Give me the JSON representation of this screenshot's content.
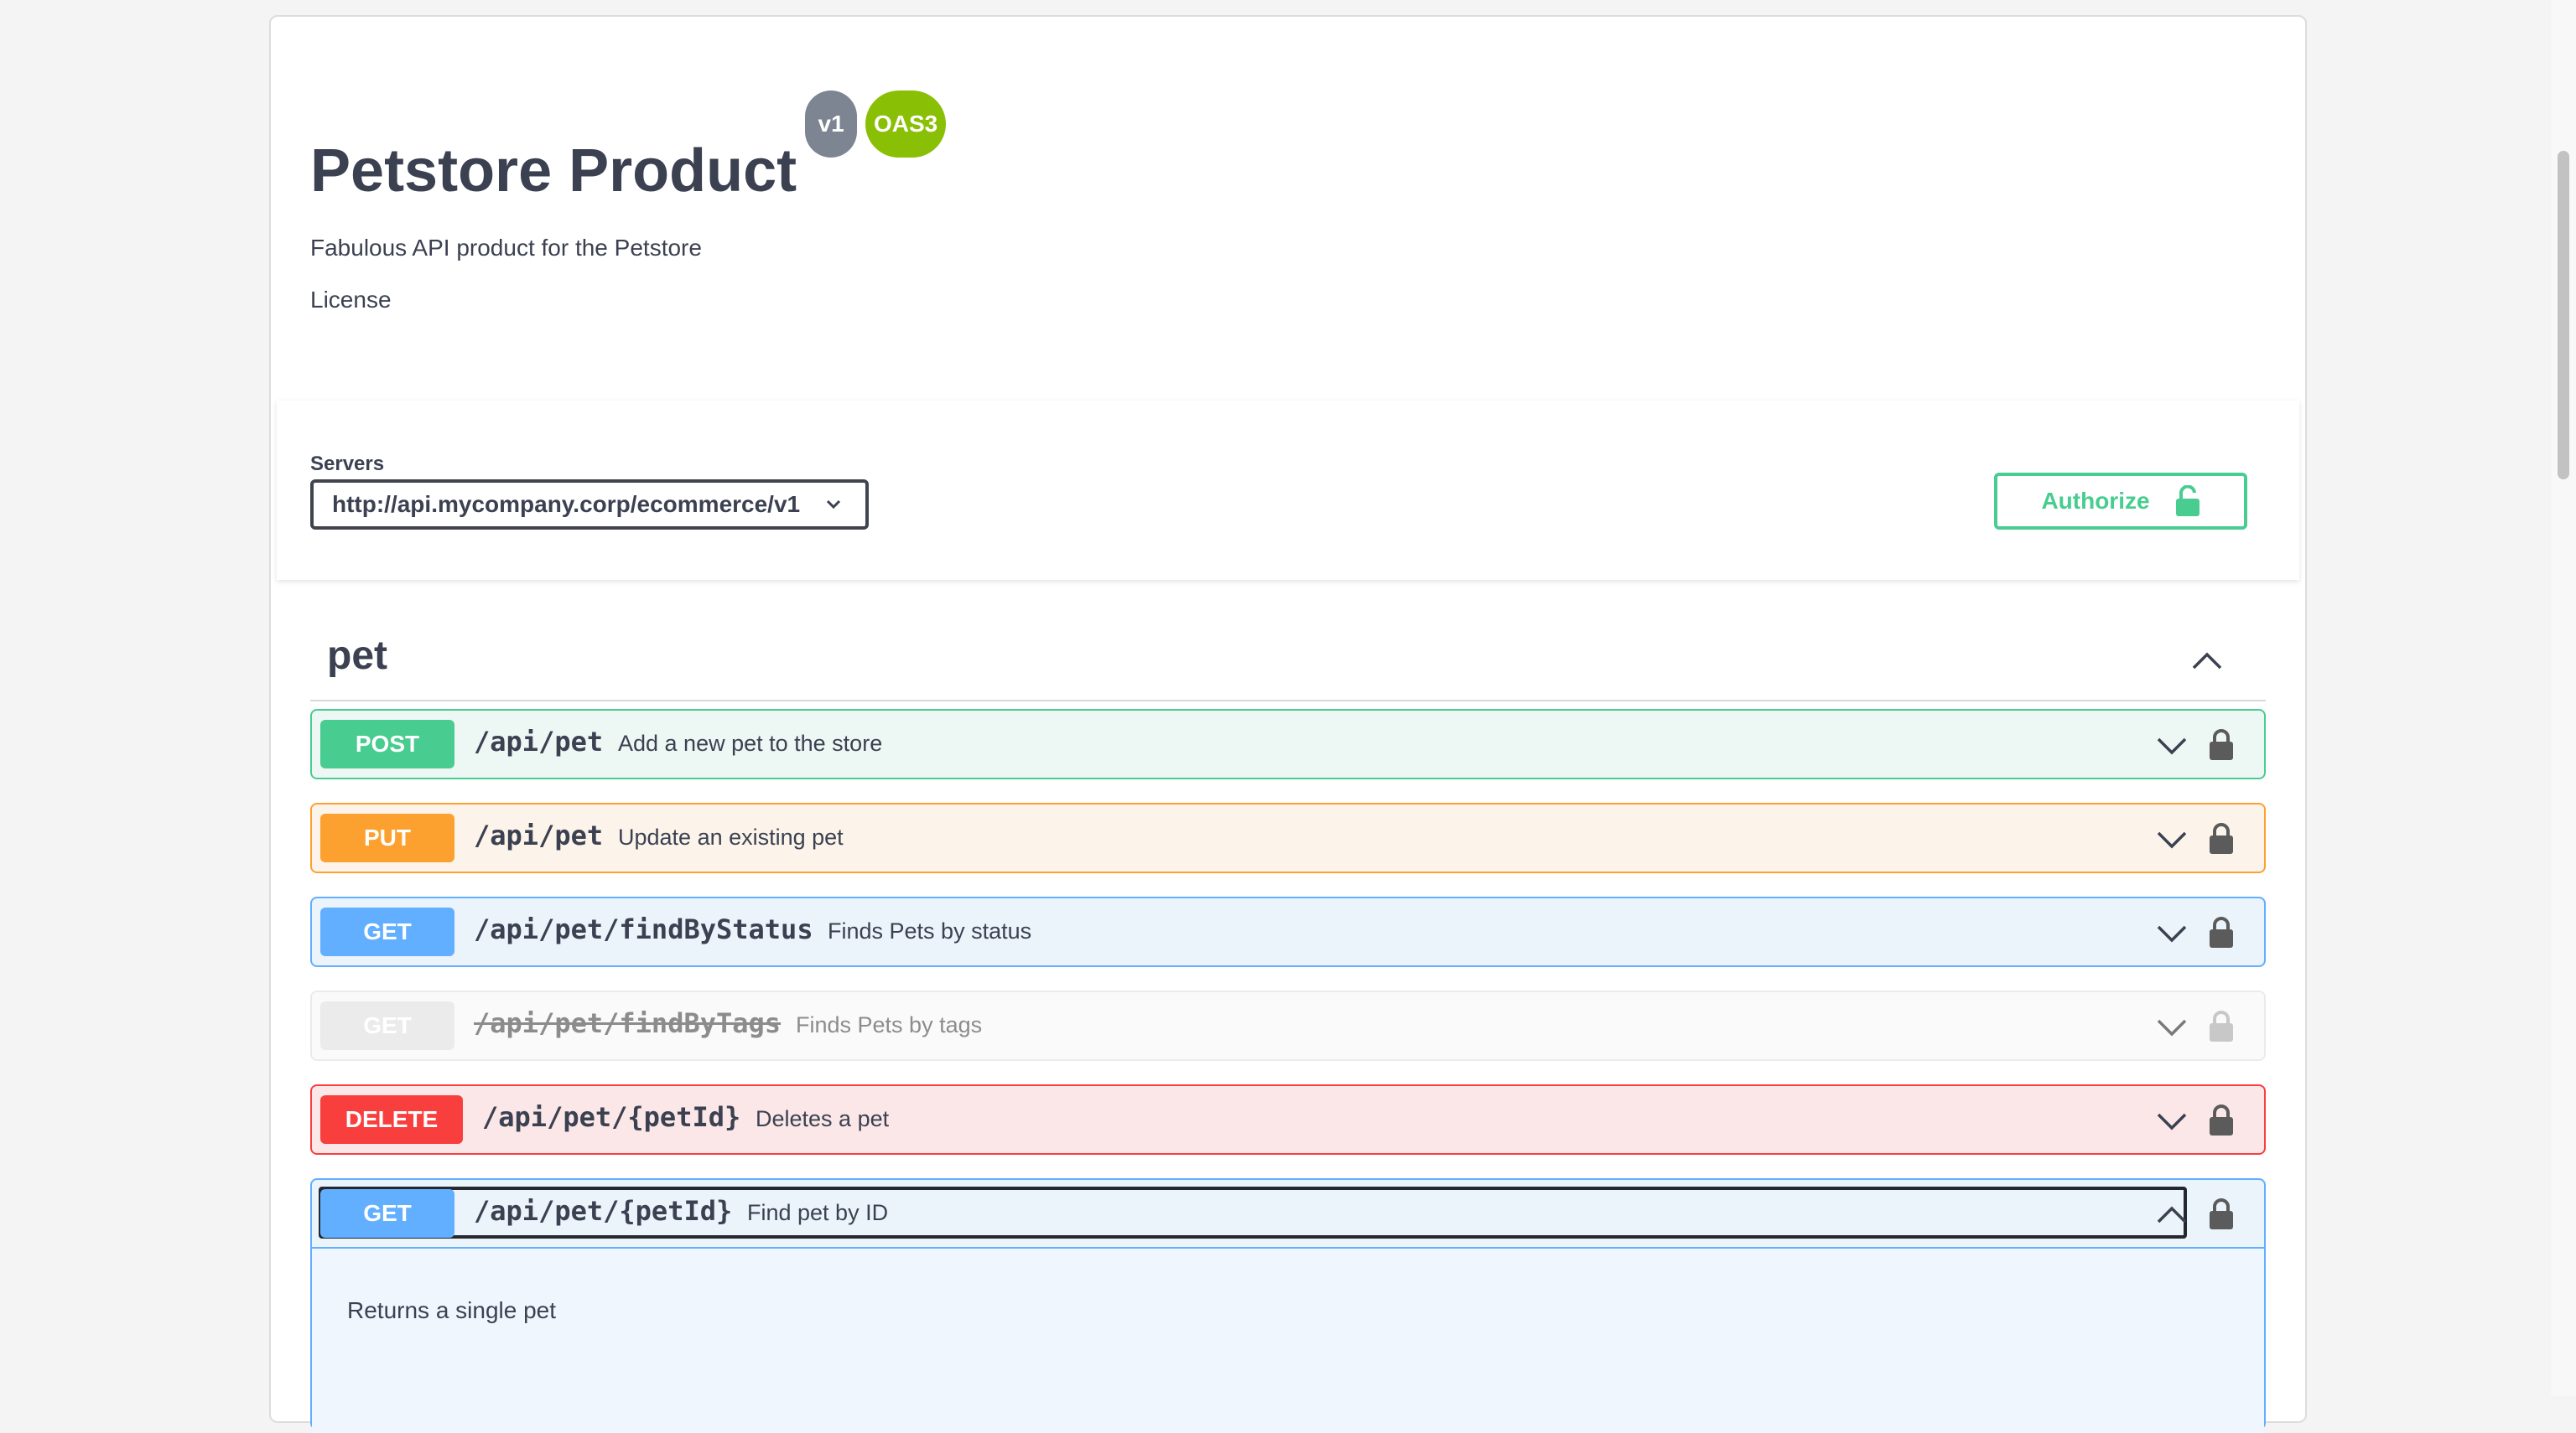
{
  "info": {
    "title": "Petstore Product",
    "version_badge": "v1",
    "oas_badge": "OAS3",
    "description": "Fabulous API product for the Petstore",
    "license_link": "License"
  },
  "servers": {
    "label": "Servers",
    "selected": "http://api.mycompany.corp/ecommerce/v1"
  },
  "authorize": {
    "label": "Authorize",
    "icon": "unlock-icon"
  },
  "tag": {
    "name": "pet",
    "expanded": true
  },
  "operations": [
    {
      "method": "POST",
      "path": "/api/pet",
      "summary": "Add a new pet to the store"
    },
    {
      "method": "PUT",
      "path": "/api/pet",
      "summary": "Update an existing pet"
    },
    {
      "method": "GET",
      "path": "/api/pet/findByStatus",
      "summary": "Finds Pets by status"
    },
    {
      "method": "GET",
      "path": "/api/pet/findByTags",
      "summary": "Finds Pets by tags",
      "deprecated": true
    },
    {
      "method": "DELETE",
      "path": "/api/pet/{petId}",
      "summary": "Deletes a pet"
    },
    {
      "method": "GET",
      "path": "/api/pet/{petId}",
      "summary": "Find pet by ID",
      "expanded": true,
      "description": "Returns a single pet"
    }
  ],
  "colors": {
    "post": "#49cc90",
    "put": "#fca130",
    "get": "#61affe",
    "delete": "#f93e3e",
    "deprecated": "#ebebeb"
  }
}
